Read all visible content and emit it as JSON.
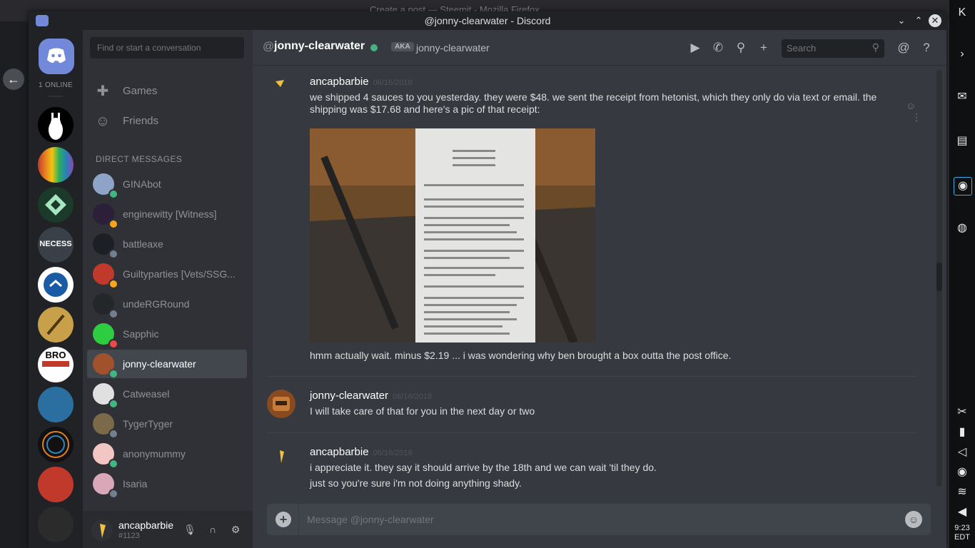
{
  "bg_window": {
    "title": "Create a post — Steemit - Mozilla Firefox"
  },
  "titlebar": {
    "title": "@jonny-clearwater - Discord"
  },
  "guilds": {
    "online_count": "1 ONLINE"
  },
  "dm_sidebar": {
    "search_placeholder": "Find or start a conversation",
    "nav": [
      {
        "label": "Games"
      },
      {
        "label": "Friends"
      }
    ],
    "section_header": "DIRECT MESSAGES",
    "items": [
      {
        "name": "GINAbot",
        "status": "online"
      },
      {
        "name": "enginewitty [Witness]",
        "status": "idle"
      },
      {
        "name": "battleaxe",
        "status": "offline"
      },
      {
        "name": "Guiltyparties [Vets/SSG...",
        "status": "idle"
      },
      {
        "name": "undeRGRound",
        "status": "offline"
      },
      {
        "name": "Sapphic",
        "status": "dnd"
      },
      {
        "name": "jonny-clearwater",
        "status": "online"
      },
      {
        "name": "Catweasel",
        "status": "online"
      },
      {
        "name": "TygerTyger",
        "status": "offline"
      },
      {
        "name": "anonymummy",
        "status": "online"
      },
      {
        "name": "Isaria",
        "status": "offline"
      }
    ]
  },
  "user": {
    "name": "ancapbarbie",
    "discriminator": "#1123"
  },
  "chat_header": {
    "at": "@",
    "name": "jonny-clearwater",
    "aka_badge": "AKA",
    "aka_name": "jonny-clearwater",
    "search_placeholder": "Search"
  },
  "messages": [
    {
      "author": "ancapbarbie",
      "time": "06/16/2018",
      "lines": [
        "we shipped 4 sauces to you yesterday. they were $48. we sent the receipt from hetonist, which they only do via text or email. the shipping was $17.68 and here's a pic of that receipt:",
        "hmm actually wait. minus $2.19 ... i was wondering why ben brought a box outta the post office."
      ]
    },
    {
      "author": "jonny-clearwater",
      "time": "06/16/2018",
      "lines": [
        "I will take care of that for you in the next day or two"
      ]
    },
    {
      "author": "ancapbarbie",
      "time": "06/16/2018",
      "lines": [
        "i appreciate it. they say it should arrive by the 18th and we can wait 'til they do.",
        "just so you're sure i'm not doing anything shady."
      ]
    }
  ],
  "composer": {
    "placeholder": "Message @jonny-clearwater"
  },
  "tray": {
    "time": "9:23",
    "tz": "EDT"
  },
  "colors": {
    "blurple": "#7289da",
    "online": "#43b581",
    "idle": "#faa61a",
    "dnd": "#f04747",
    "offline": "#747f8d"
  }
}
